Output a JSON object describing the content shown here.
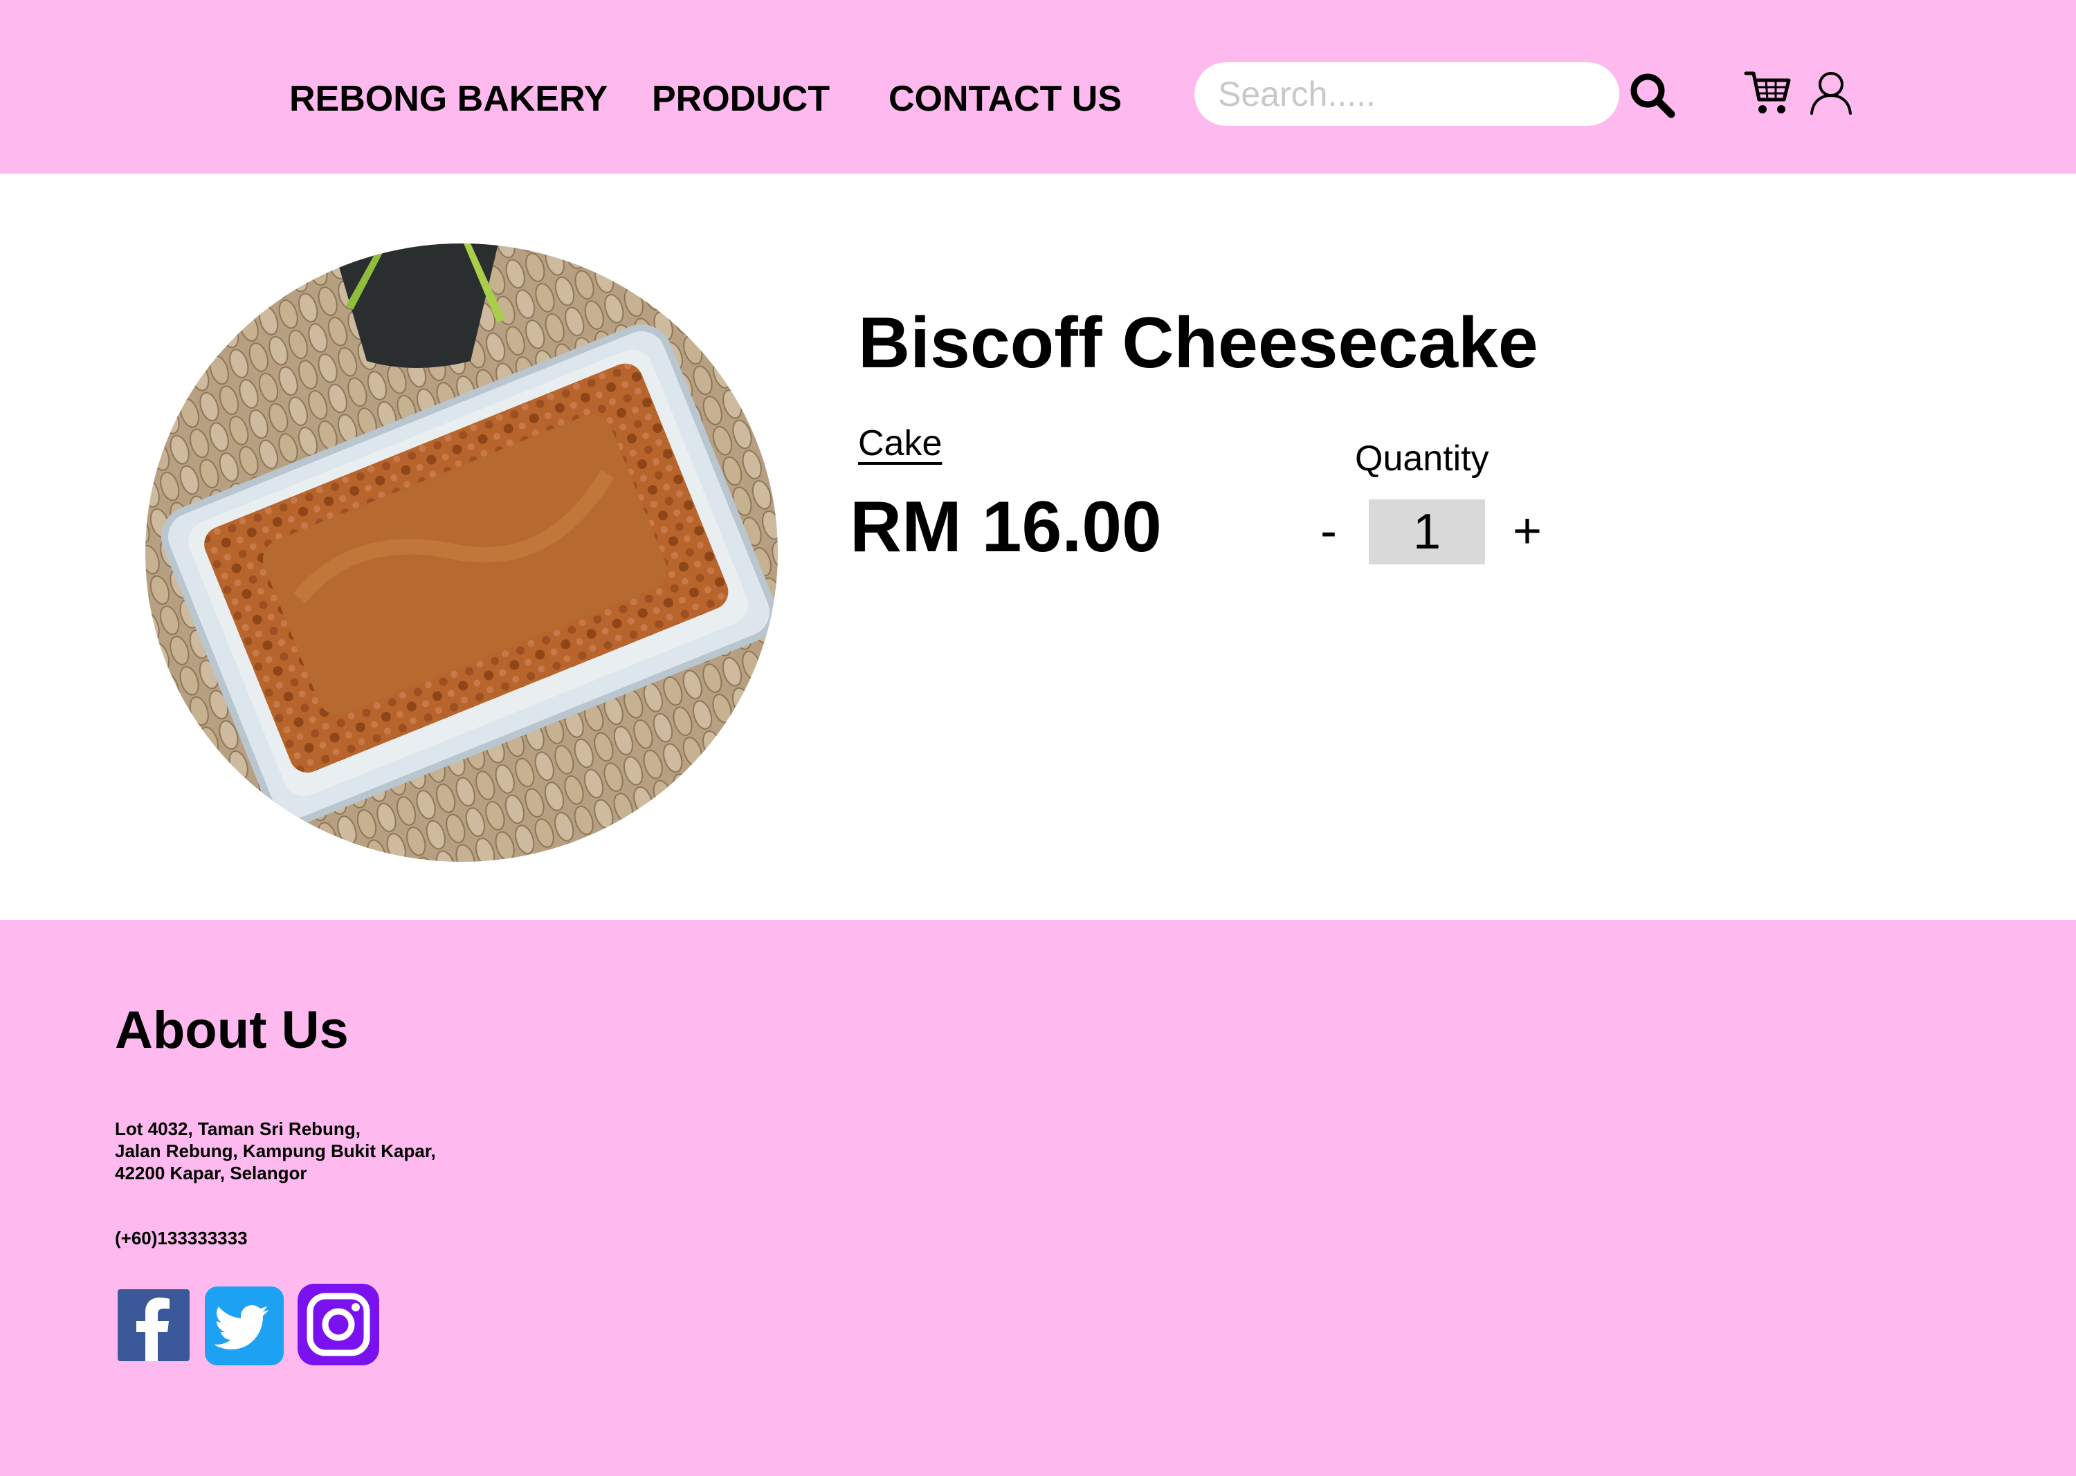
{
  "header": {
    "brand": "REBONG BAKERY",
    "nav": {
      "product": "PRODUCT",
      "contact": "CONTACT US"
    },
    "search": {
      "placeholder": "Search....."
    },
    "icons": {
      "search": "search-icon",
      "cart": "cart-icon",
      "user": "user-icon"
    },
    "background": "#FEBAEE"
  },
  "product": {
    "title": "Biscoff Cheesecake",
    "category": "Cake",
    "price": "RM 16.00",
    "quantity_label": "Quantity",
    "quantity_minus": "-",
    "quantity_value": "1",
    "quantity_plus": "+"
  },
  "footer": {
    "about_title": "About Us",
    "address_lines": [
      "Lot 4032, Taman Sri Rebung,",
      "Jalan Rebung, Kampung Bukit Kapar,",
      "42200 Kapar, Selangor"
    ],
    "phone": "(+60)133333333",
    "social": [
      "facebook-icon",
      "twitter-icon",
      "instagram-icon"
    ],
    "colors": {
      "facebook": "#3B5998",
      "twitter": "#1DA1F2",
      "instagram": "#7A12F0"
    }
  }
}
